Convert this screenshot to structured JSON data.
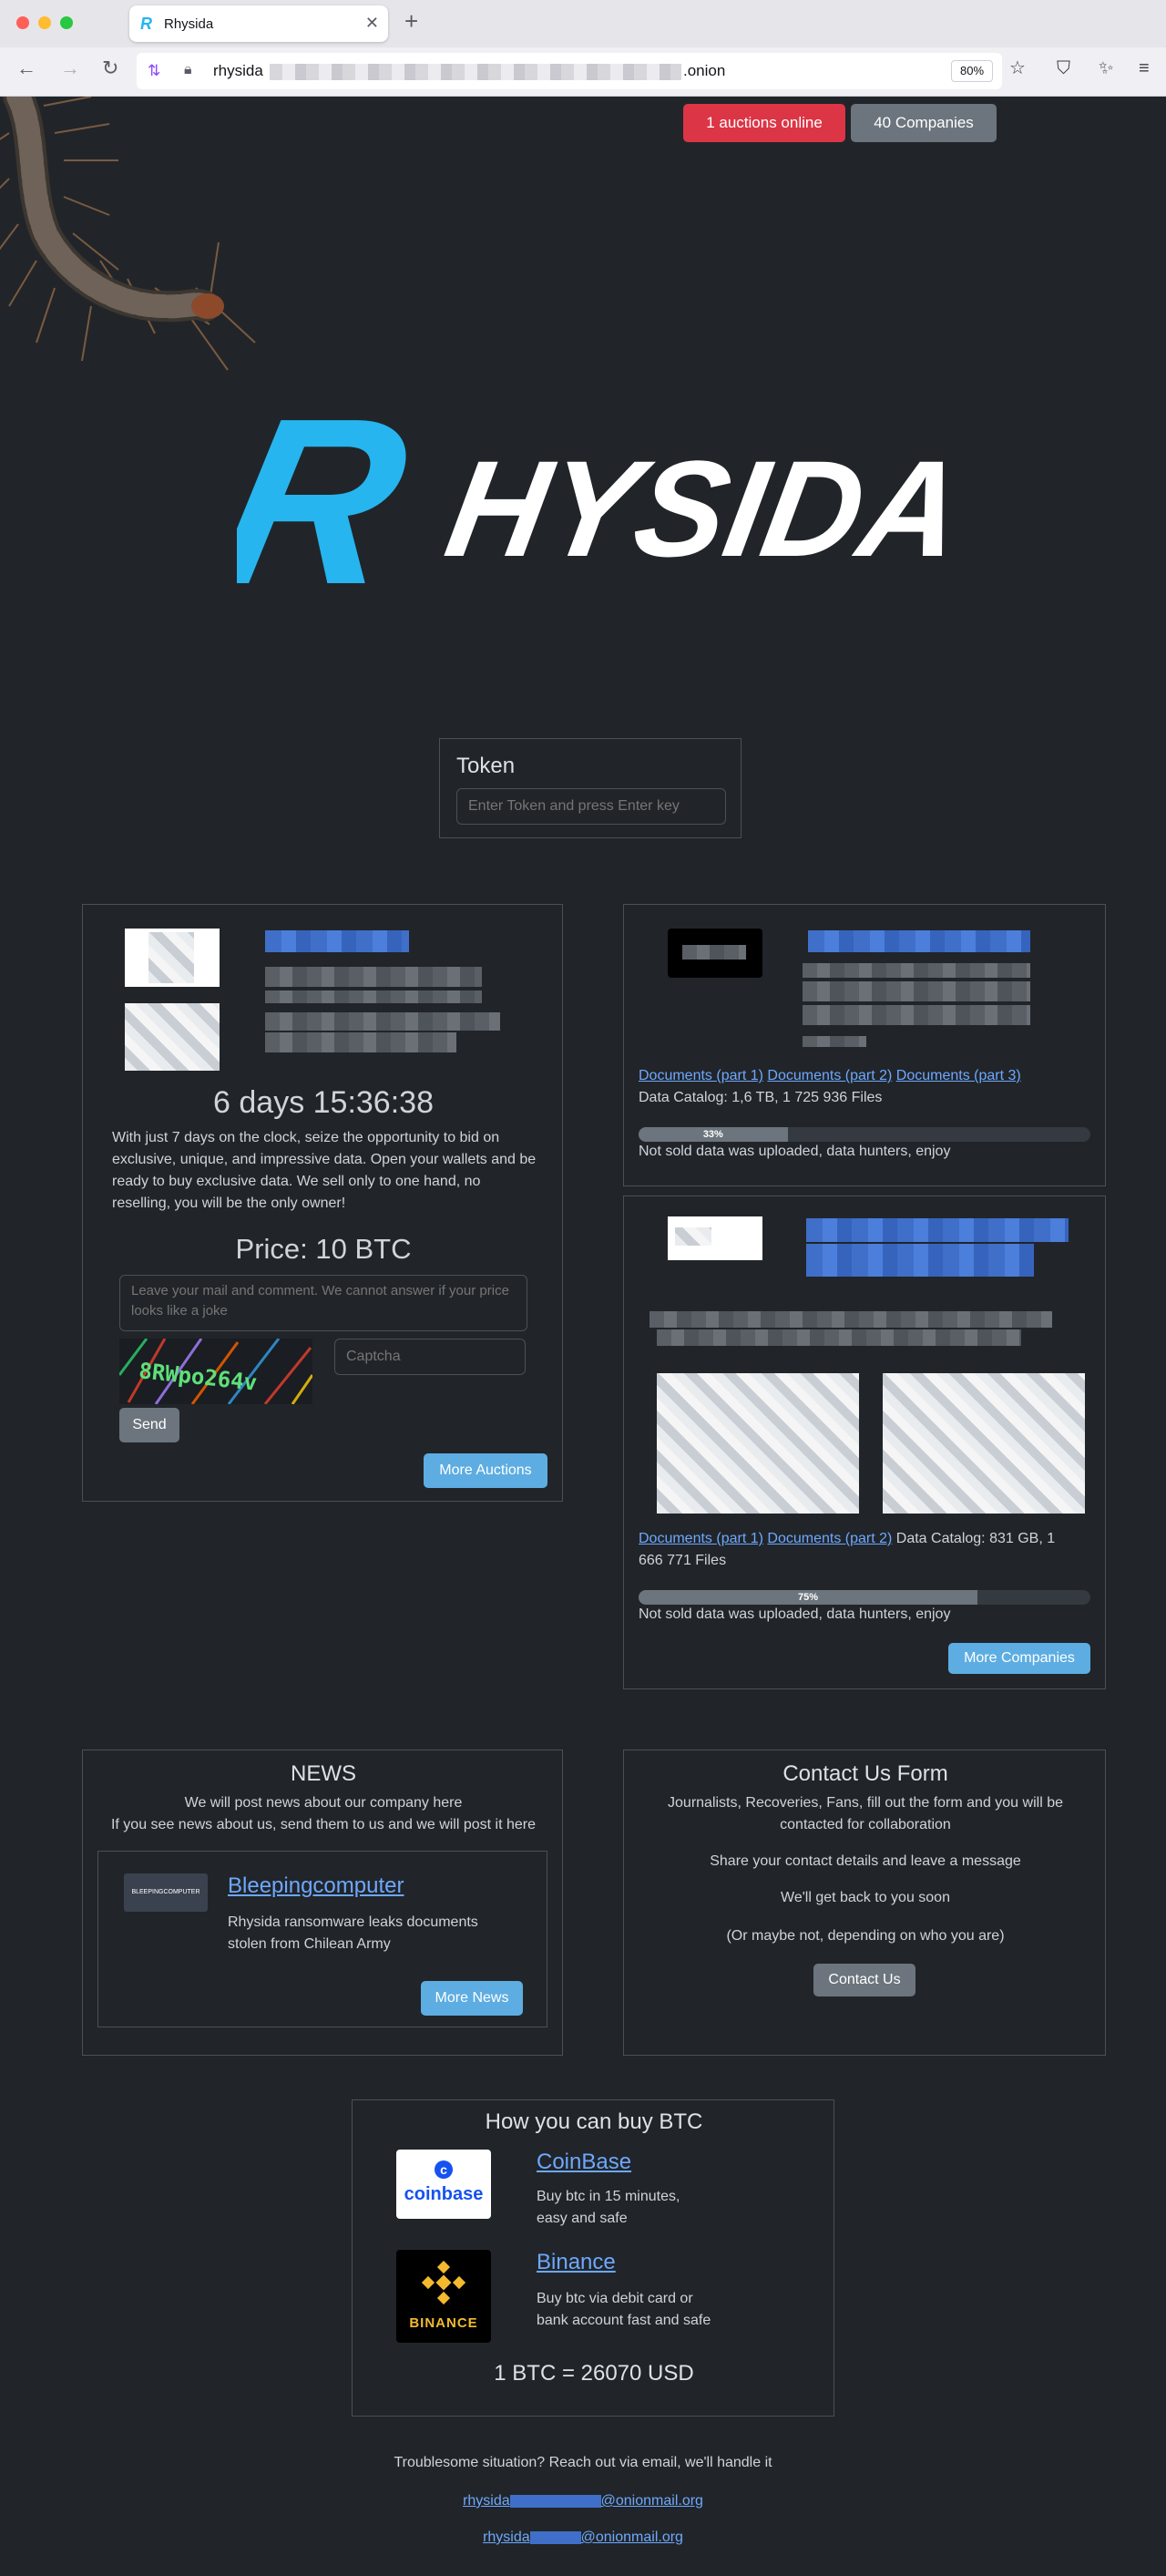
{
  "browser": {
    "tab_title": "Rhysida",
    "tab_favicon": "R",
    "url_prefix": "rhysida",
    "url_suffix": ".onion",
    "zoom": "80%"
  },
  "header": {
    "auctions_badge": "1 auctions online",
    "companies_badge": "40 Companies"
  },
  "logo": {
    "first_letter": "R",
    "rest": "HYSIDA",
    "accent_color": "#26b5ef"
  },
  "token": {
    "label": "Token",
    "placeholder": "Enter Token and press Enter key"
  },
  "auction": {
    "countdown": "6 days 15:36:38",
    "description": "With just 7 days on the clock, seize the opportunity to bid on exclusive, unique, and impressive data. Open your wallets and be ready to buy exclusive data. We sell only to one hand, no reselling, you will be the only owner!",
    "price": "Price: 10 BTC",
    "comment_placeholder": "Leave your mail and comment. We cannot answer if your price looks like a joke",
    "captcha_text": "8RWpo264v",
    "captcha_placeholder": "Captcha",
    "send_label": "Send",
    "more_auctions_label": "More Auctions"
  },
  "companies": [
    {
      "links": [
        "Documents (part 1)",
        "Documents (part 2)",
        "Documents (part 3)"
      ],
      "catalog": "Data Catalog: 1,6 TB, 1 725 936 Files",
      "progress_label": "33%",
      "progress": 0.33,
      "note": "Not sold data was uploaded, data hunters, enjoy"
    },
    {
      "links": [
        "Documents (part 1)",
        "Documents (part 2)"
      ],
      "catalog_a": "Data Catalog: 831 GB, 1",
      "catalog_b": "666 771 Files",
      "progress_label": "75%",
      "progress": 0.75,
      "note": "Not sold data was uploaded, data hunters, enjoy"
    }
  ],
  "more_companies_label": "More Companies",
  "news": {
    "title": "NEWS",
    "line1": "We will post news about our company here",
    "line2": "If you see news about us, send them to us and we will post it here",
    "item_logo": "BLEEPINGCOMPUTER",
    "item_title": "Bleepingcomputer",
    "item_text_1": "Rhysida ransomware leaks documents",
    "item_text_2": "stolen from Chilean Army",
    "more_label": "More News"
  },
  "contact": {
    "title": "Contact Us Form",
    "line1": "Journalists, Recoveries, Fans, fill out the form and you will be",
    "line2": "contacted for collaboration",
    "line3": "Share your contact details and leave a message",
    "line4": "We'll get back to you soon",
    "line5": "(Or maybe not, depending on who you are)",
    "button_label": "Contact Us"
  },
  "btc": {
    "title": "How you can buy BTC",
    "coinbase_name": "CoinBase",
    "coinbase_logo": "coinbase",
    "coinbase_text_1": "Buy btc in 15 minutes,",
    "coinbase_text_2": "easy and safe",
    "binance_name": "Binance",
    "binance_logo": "BINANCE",
    "binance_text_1": "Buy btc via debit card or",
    "binance_text_2": "bank account fast and safe",
    "rate": "1 BTC = 26070 USD"
  },
  "footer": {
    "text": "Troublesome situation? Reach out via email, we'll handle it",
    "email1_prefix": "rhysida",
    "email1_suffix": "@onionmail.org",
    "email2_prefix": "rhysida",
    "email2_suffix": "@onionmail.org"
  }
}
